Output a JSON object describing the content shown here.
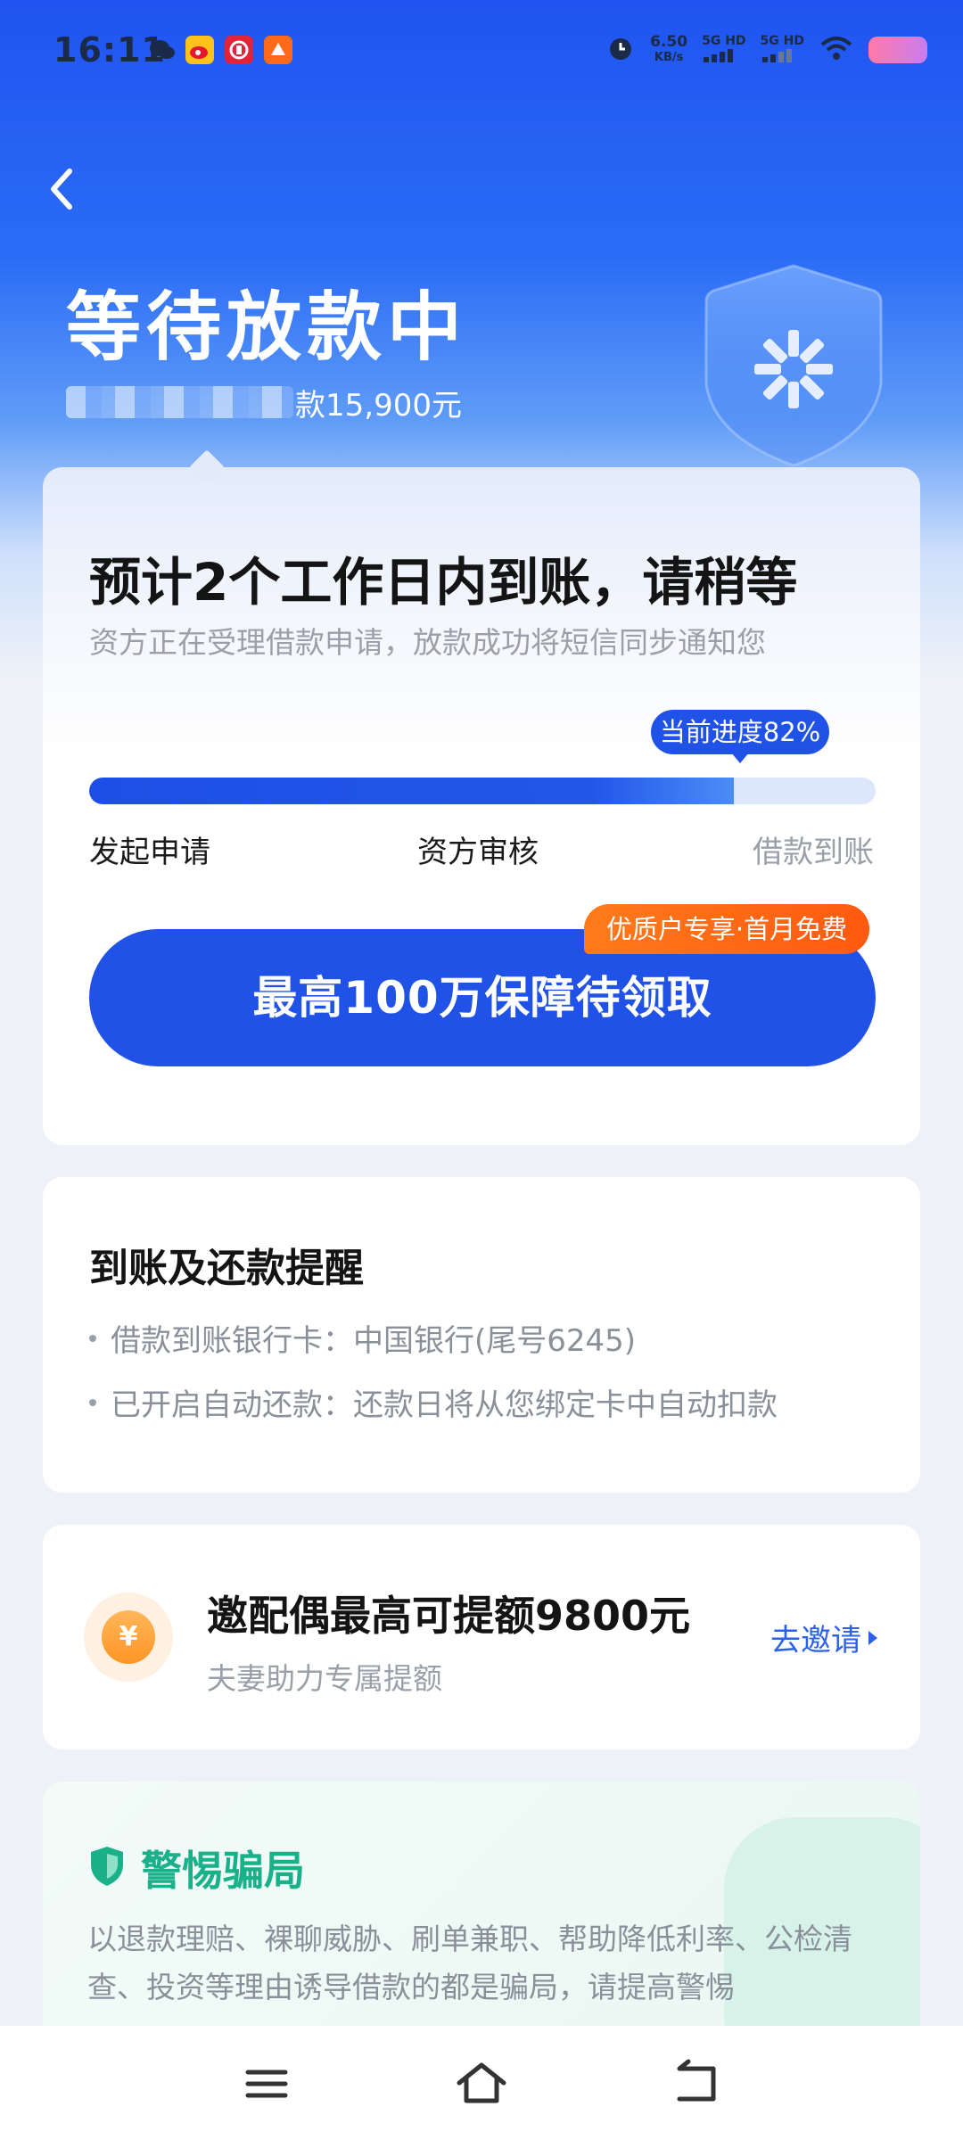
{
  "status_bar": {
    "time": "16:11",
    "net_speed_value": "6.50",
    "net_speed_unit": "KB/s",
    "sim1": "5G HD",
    "sim2": "5G HD"
  },
  "header": {
    "title": "等待放款中",
    "loan_text": "款15,900元"
  },
  "status_card": {
    "title": "预计2个工作日内到账，请稍等",
    "subtitle": "资方正在受理借款申请，放款成功将短信同步通知您",
    "progress_label": "当前进度82%",
    "progress_value": 0.82,
    "steps": [
      "发起申请",
      "资方审核",
      "借款到账"
    ],
    "cta_label": "最高100万保障待领取",
    "promo_badge": "优质户专享·首月免费"
  },
  "reminder_card": {
    "title": "到账及还款提醒",
    "items": [
      "借款到账银行卡：中国银行(尾号6245)",
      "已开启自动还款：还款日将从您绑定卡中自动扣款"
    ]
  },
  "invite_card": {
    "coin_symbol": "¥",
    "title": "邀配偶最高可提额9800元",
    "subtitle": "夫妻助力专属提额",
    "link_label": "去邀请"
  },
  "fraud_card": {
    "title": "警惕骗局",
    "text": "以退款理赔、裸聊威胁、刷单兼职、帮助降低利率、公检清查、投资等理由诱导借款的都是骗局，请提高警惕"
  },
  "colors": {
    "primary": "#2052e8",
    "promo": "#ff6a14",
    "safety_green": "#19b08a"
  }
}
